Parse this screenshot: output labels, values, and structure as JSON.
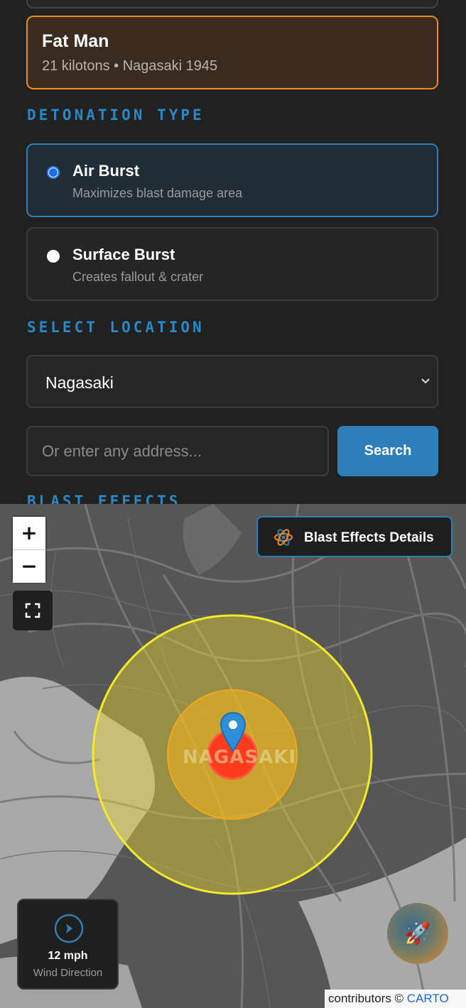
{
  "weapon": {
    "name": "Fat Man",
    "detail": "21 kilotons • Nagasaki 1945"
  },
  "detonation": {
    "title": "DETONATION TYPE",
    "options": [
      {
        "label": "Air Burst",
        "description": "Maximizes blast damage area",
        "selected": true
      },
      {
        "label": "Surface Burst",
        "description": "Creates fallout & crater",
        "selected": false
      }
    ]
  },
  "location": {
    "title": "SELECT LOCATION",
    "selected": "Nagasaki",
    "address_placeholder": "Or enter any address...",
    "search_label": "Search"
  },
  "next_section_title": "BLAST EFFECTS",
  "map": {
    "city_label": "NAGASAKI",
    "details_button": "Blast Effects Details",
    "zoom_in": "+",
    "zoom_out": "−",
    "wind_speed": "12 mph",
    "wind_label": "Wind Direction",
    "attribution_text": "contributors © ",
    "attribution_link": "CARTO",
    "rocket_icon": "🚀"
  },
  "colors": {
    "accent_blue": "#2c7fb8",
    "accent_orange": "#f08a1c",
    "fireball": "#ff3b1f",
    "blast_inner": "#f5b21e",
    "blast_outer": "#f0e02a"
  }
}
